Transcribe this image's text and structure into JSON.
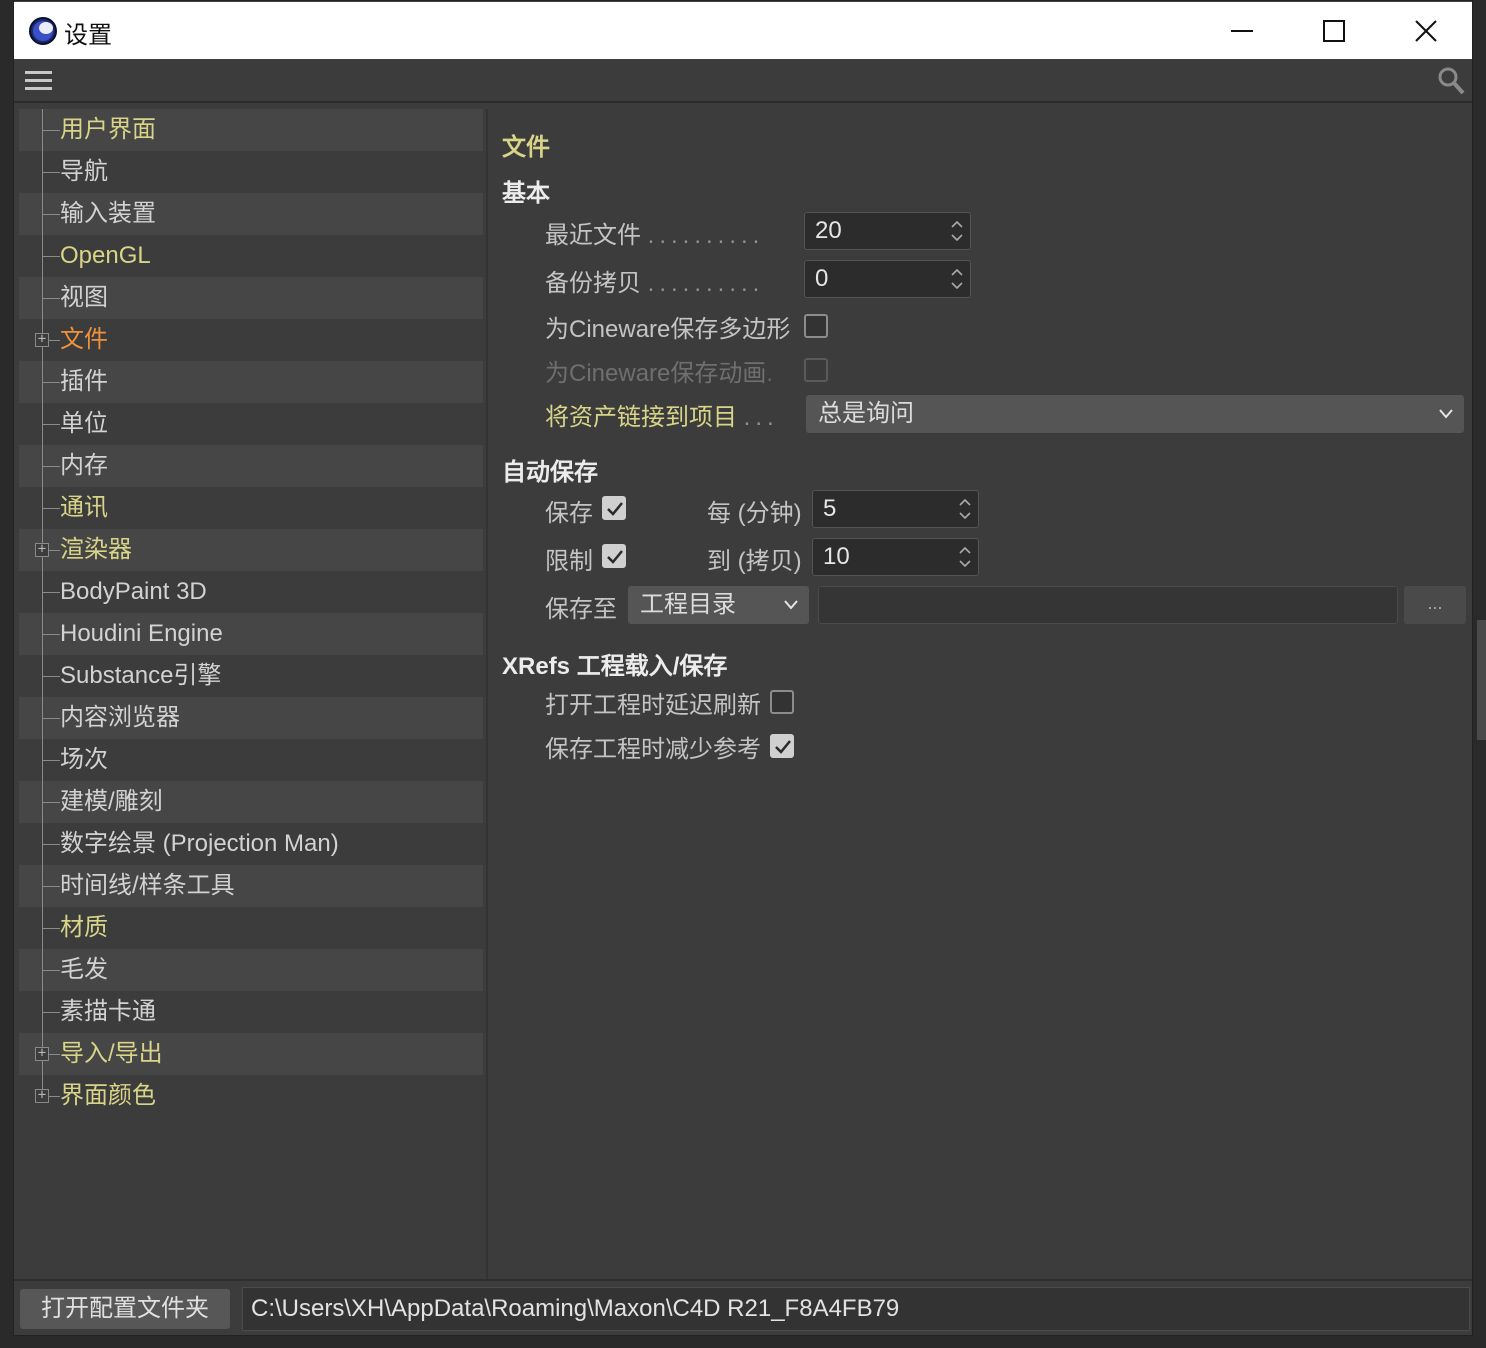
{
  "window": {
    "title": "设置"
  },
  "tree": {
    "items": [
      {
        "label": "用户界面",
        "color": "yellow",
        "plus": false
      },
      {
        "label": "导航",
        "color": "normal",
        "plus": false
      },
      {
        "label": "输入装置",
        "color": "normal",
        "plus": false
      },
      {
        "label": "OpenGL",
        "color": "yellow",
        "plus": false
      },
      {
        "label": "视图",
        "color": "normal",
        "plus": false
      },
      {
        "label": "文件",
        "color": "orange",
        "plus": true
      },
      {
        "label": "插件",
        "color": "normal",
        "plus": false
      },
      {
        "label": "单位",
        "color": "normal",
        "plus": false
      },
      {
        "label": "内存",
        "color": "normal",
        "plus": false
      },
      {
        "label": "通讯",
        "color": "yellow",
        "plus": false
      },
      {
        "label": "渲染器",
        "color": "yellow",
        "plus": true
      },
      {
        "label": "BodyPaint 3D",
        "color": "normal",
        "plus": false
      },
      {
        "label": "Houdini Engine",
        "color": "normal",
        "plus": false
      },
      {
        "label": "Substance引擎",
        "color": "normal",
        "plus": false
      },
      {
        "label": "内容浏览器",
        "color": "normal",
        "plus": false
      },
      {
        "label": "场次",
        "color": "normal",
        "plus": false
      },
      {
        "label": "建模/雕刻",
        "color": "normal",
        "plus": false
      },
      {
        "label": "数字绘景 (Projection Man)",
        "color": "normal",
        "plus": false
      },
      {
        "label": "时间线/样条工具",
        "color": "normal",
        "plus": false
      },
      {
        "label": "材质",
        "color": "yellow",
        "plus": false
      },
      {
        "label": "毛发",
        "color": "normal",
        "plus": false
      },
      {
        "label": "素描卡通",
        "color": "normal",
        "plus": false
      },
      {
        "label": "导入/导出",
        "color": "yellow",
        "plus": true
      },
      {
        "label": "界面颜色",
        "color": "yellow",
        "plus": true
      }
    ]
  },
  "panel": {
    "heading": "文件",
    "basic": {
      "section": "基本",
      "recent_files_label": "最近文件",
      "recent_files_value": "20",
      "backup_label": "备份拷贝",
      "backup_value": "0",
      "cineware_poly_label": "为Cineware保存多边形",
      "cineware_poly_checked": false,
      "cineware_anim_label": "为Cineware保存动画",
      "cineware_anim_checked": false,
      "asset_link_label": "将资产链接到项目",
      "asset_link_value": "总是询问"
    },
    "autosave": {
      "section": "自动保存",
      "save_label": "保存",
      "save_checked": true,
      "every_label": "每 (分钟)",
      "every_value": "5",
      "limit_label": "限制",
      "limit_checked": true,
      "to_label": "到 (拷贝)",
      "to_value": "10",
      "save_to_label": "保存至",
      "save_to_value": "工程目录",
      "browse_label": "..."
    },
    "xrefs": {
      "section": "XRefs 工程载入/保存",
      "delay_refresh_label": "打开工程时延迟刷新",
      "delay_refresh_checked": false,
      "reduce_refs_label": "保存工程时减少参考",
      "reduce_refs_checked": true
    }
  },
  "footer": {
    "open_button": "打开配置文件夹",
    "path": "C:\\Users\\XH\\AppData\\Roaming\\Maxon\\C4D R21_F8A4FB79"
  },
  "colors": {
    "yellow": "#d8d488",
    "orange": "#f0923c",
    "panel": "#3c3c3c"
  }
}
